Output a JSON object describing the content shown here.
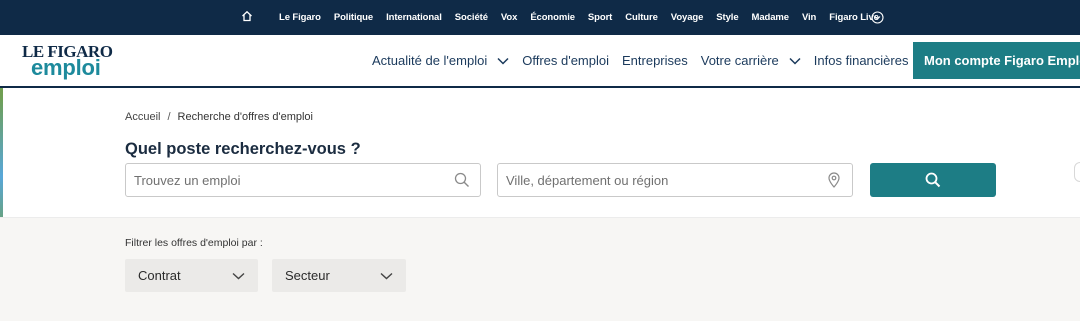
{
  "topbar": {
    "home_icon": "home-icon",
    "links": [
      "Le Figaro",
      "Politique",
      "International",
      "Société",
      "Vox",
      "Économie",
      "Sport",
      "Culture",
      "Voyage",
      "Style",
      "Madame",
      "Vin",
      "Figaro Live"
    ],
    "more_icon": "chevron-circle-icon",
    "background": "#0f2a47"
  },
  "header": {
    "logo_line1": "LE FIGARO",
    "logo_line2": "emploi",
    "nav": [
      {
        "label": "Actualité de l'emploi",
        "has_dropdown": true
      },
      {
        "label": "Offres d'emploi",
        "has_dropdown": false
      },
      {
        "label": "Entreprises",
        "has_dropdown": false
      },
      {
        "label": "Votre carrière",
        "has_dropdown": true
      },
      {
        "label": "Infos financières",
        "has_dropdown": false
      }
    ],
    "account_button": "Mon compte Figaro Emploi",
    "accent": "#1d7d85"
  },
  "search": {
    "breadcrumb": {
      "home": "Accueil",
      "separator": "/",
      "current": "Recherche d'offres d'emploi"
    },
    "title": "Quel poste recherchez-vous ?",
    "job_placeholder": "Trouvez un emploi",
    "job_value": "",
    "location_placeholder": "Ville, département ou région",
    "location_value": "",
    "button_icon": "search-icon"
  },
  "filters": {
    "label": "Filtrer les offres d'emploi par :",
    "contrat": "Contrat",
    "secteur": "Secteur"
  }
}
